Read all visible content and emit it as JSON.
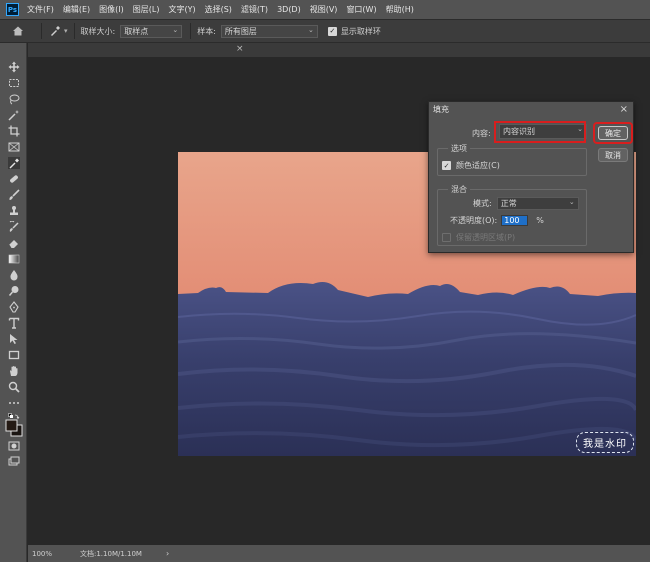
{
  "app": {
    "logo_text": "Ps"
  },
  "menu": [
    "文件(F)",
    "编辑(E)",
    "图像(I)",
    "图层(L)",
    "文字(Y)",
    "选择(S)",
    "滤镜(T)",
    "3D(D)",
    "视图(V)",
    "窗口(W)",
    "帮助(H)"
  ],
  "options_bar": {
    "sample_size_label": "取样大小:",
    "sample_size_value": "取样点",
    "sample_label": "样本:",
    "sample_value": "所有图层",
    "show_ring_label": "显示取样环",
    "show_ring_checked": true
  },
  "tab": {
    "close_glyph": "×"
  },
  "status_bar": {
    "zoom": "100%",
    "doc_info": "文档:1.10M/1.10M",
    "arrow": "›"
  },
  "watermark": "我是水印",
  "dialog": {
    "title": "填充",
    "close_glyph": "×",
    "content_label": "内容:",
    "content_value": "内容识别",
    "ok_label": "确定",
    "cancel_label": "取消",
    "options_group": "选项",
    "color_adapt_label": "颜色适应(C)",
    "color_adapt_checked": true,
    "blend_group": "混合",
    "mode_label": "模式:",
    "mode_value": "正常",
    "opacity_label": "不透明度(O):",
    "opacity_value": "100",
    "opacity_unit": "%",
    "preserve_transparency_label": "保留透明区域(P)",
    "preserve_transparency_enabled": false
  },
  "colors": {
    "sky_top": "#e8a48a",
    "sky_horizon": "#d4715a",
    "clouds": "#3a4170",
    "highlight_red": "#d81e1e",
    "selection_blue": "#1f6fc7"
  }
}
